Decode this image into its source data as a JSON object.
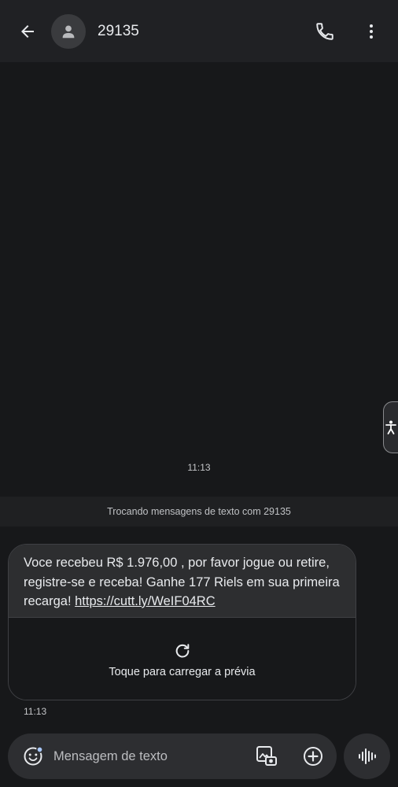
{
  "header": {
    "title": "29135",
    "back_icon": "arrow-back-icon",
    "avatar_icon": "person-icon",
    "call_icon": "phone-icon",
    "more_icon": "more-vert-icon"
  },
  "conversation": {
    "top_timestamp": "11:13",
    "banner": "Trocando mensagens de texto com 29135",
    "message": {
      "text": "Voce recebeu R$ 1.976,00 , por favor jogue ou retire, registre-se e receba! Ganhe 177 Riels em sua primeira recarga! ",
      "link": "https://cutt.ly/WeIF04RC",
      "preview_label": "Toque para carregar a prévia",
      "time": "11:13"
    }
  },
  "composer": {
    "placeholder": "Mensagem de texto"
  },
  "colors": {
    "background": "#17181a",
    "appbar": "#202124",
    "bubble": "#2d2e30",
    "text": "#e8eaed"
  }
}
